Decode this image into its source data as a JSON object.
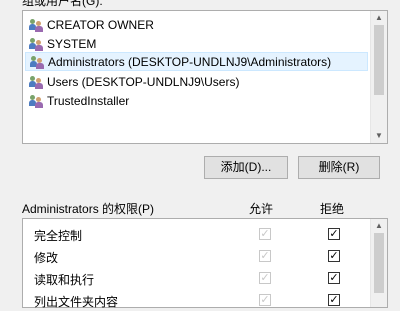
{
  "principals": {
    "group_label": "组或用户名(G):",
    "items": [
      {
        "label": "CREATOR OWNER",
        "icon": "users-icon"
      },
      {
        "label": "SYSTEM",
        "icon": "users-icon"
      },
      {
        "label": "Administrators (DESKTOP-UNDLNJ9\\Administrators)",
        "icon": "users-icon",
        "selected": true
      },
      {
        "label": "Users (DESKTOP-UNDLNJ9\\Users)",
        "icon": "users-icon"
      },
      {
        "label": "TrustedInstaller",
        "icon": "users-icon"
      }
    ]
  },
  "buttons": {
    "add": "添加(D)...",
    "remove": "删除(R)"
  },
  "permissions": {
    "label": "Administrators 的权限(P)",
    "allow_header": "允许",
    "deny_header": "拒绝",
    "rows": [
      {
        "name": "完全控制",
        "allow": true,
        "allow_disabled": true,
        "deny": true
      },
      {
        "name": "修改",
        "allow": true,
        "allow_disabled": true,
        "deny": true
      },
      {
        "name": "读取和执行",
        "allow": true,
        "allow_disabled": true,
        "deny": true
      },
      {
        "name": "列出文件夹内容",
        "allow": true,
        "allow_disabled": true,
        "deny": true
      }
    ]
  },
  "check_glyph": "✓"
}
